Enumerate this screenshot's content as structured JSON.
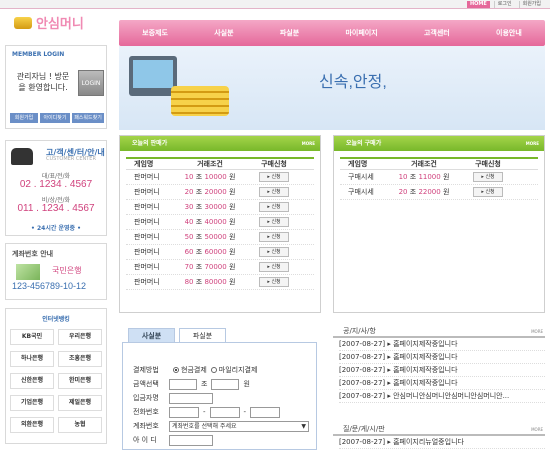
{
  "toplinks": [
    "HOME",
    "로그인",
    "회원가입"
  ],
  "logo": "안심머니",
  "login": {
    "title": "MEMBER LOGIN",
    "message": "관리자님 ! 방문을 환영합니다.",
    "button": "LOGIN",
    "links": [
      "회원가입",
      "아이디찾기",
      "패스워드찾기"
    ]
  },
  "center": {
    "title": "고/객/센/터/안/내",
    "subtitle": "CUSTOMER CENTER",
    "phone_label": "대/표/전/화",
    "phone": "02 . 1234 . 4567",
    "mobile_label": "비/상/전/화",
    "mobile": "011 . 1234 . 4567",
    "hours": "• 24시간 운영중 •"
  },
  "account": {
    "title": "계좌번호 안내",
    "bank": "국민은행",
    "number": "123-456789-10-12"
  },
  "banks": {
    "title": "인터넷뱅킹",
    "items": [
      "KB국민",
      "우리은행",
      "하나은행",
      "조흥은행",
      "신한은행",
      "한미은행",
      "기업은행",
      "제일은행",
      "외환은행",
      "농협"
    ]
  },
  "nav": [
    "보증제도",
    "사실분",
    "파실분",
    "마이페이지",
    "고객센터",
    "이용안내"
  ],
  "banner": {
    "slogan": "신속,안정,"
  },
  "sell": {
    "title": "오늘의 판매가",
    "more": "MORE",
    "headers": [
      "게임명",
      "거래조건",
      "구매신청"
    ],
    "button": "신청",
    "rows": [
      {
        "game": "판머머니",
        "qty": "10",
        "unit": "조",
        "price": "10000",
        "won": "원"
      },
      {
        "game": "판머머니",
        "qty": "20",
        "unit": "조",
        "price": "20000",
        "won": "원"
      },
      {
        "game": "판머머니",
        "qty": "30",
        "unit": "조",
        "price": "30000",
        "won": "원"
      },
      {
        "game": "판머머니",
        "qty": "40",
        "unit": "조",
        "price": "40000",
        "won": "원"
      },
      {
        "game": "판머머니",
        "qty": "50",
        "unit": "조",
        "price": "50000",
        "won": "원"
      },
      {
        "game": "판머머니",
        "qty": "60",
        "unit": "조",
        "price": "60000",
        "won": "원"
      },
      {
        "game": "판머머니",
        "qty": "70",
        "unit": "조",
        "price": "70000",
        "won": "원"
      },
      {
        "game": "판머머니",
        "qty": "80",
        "unit": "조",
        "price": "80000",
        "won": "원"
      }
    ]
  },
  "buy": {
    "title": "오늘의 구매가",
    "more": "MORE",
    "headers": [
      "게임명",
      "거래조건",
      "구매신청"
    ],
    "button": "신청",
    "rows": [
      {
        "game": "구매시세",
        "qty": "10",
        "unit": "조",
        "price": "11000",
        "won": "원"
      },
      {
        "game": "구매시세",
        "qty": "20",
        "unit": "조",
        "price": "22000",
        "won": "원"
      }
    ]
  },
  "form": {
    "tabs": [
      "사실분",
      "파실분"
    ],
    "pay_label": "결제방법",
    "pay_opt1": "현금결제",
    "pay_opt2": "마일리지결제",
    "amount_label": "금액선택",
    "amount_unit1": "조",
    "amount_unit2": "원",
    "depositor_label": "입금자명",
    "phone_label": "전화번호",
    "dash": "-",
    "account_label": "계좌번호",
    "account_placeholder": "계좌번호를 선택해 주세요",
    "id_label": "아 이 디"
  },
  "notice": {
    "title": "공/지/사/항",
    "more": "MORE",
    "rows": [
      "[2007-08-27] ▸ 홈페이지제작중입니다",
      "[2007-08-27] ▸ 홈페이지제작중입니다",
      "[2007-08-27] ▸ 홈페이지제작중입니다",
      "[2007-08-27] ▸ 홈페이지제작중입니다",
      "[2007-08-27] ▸ 안심머니안심머니안심머니안심머니안..."
    ]
  },
  "qa": {
    "title": "질/문/게/시/판",
    "more": "MORE",
    "rows": [
      "[2007-08-27] ▸ 홈페이지리뉴얼중입니다"
    ]
  }
}
